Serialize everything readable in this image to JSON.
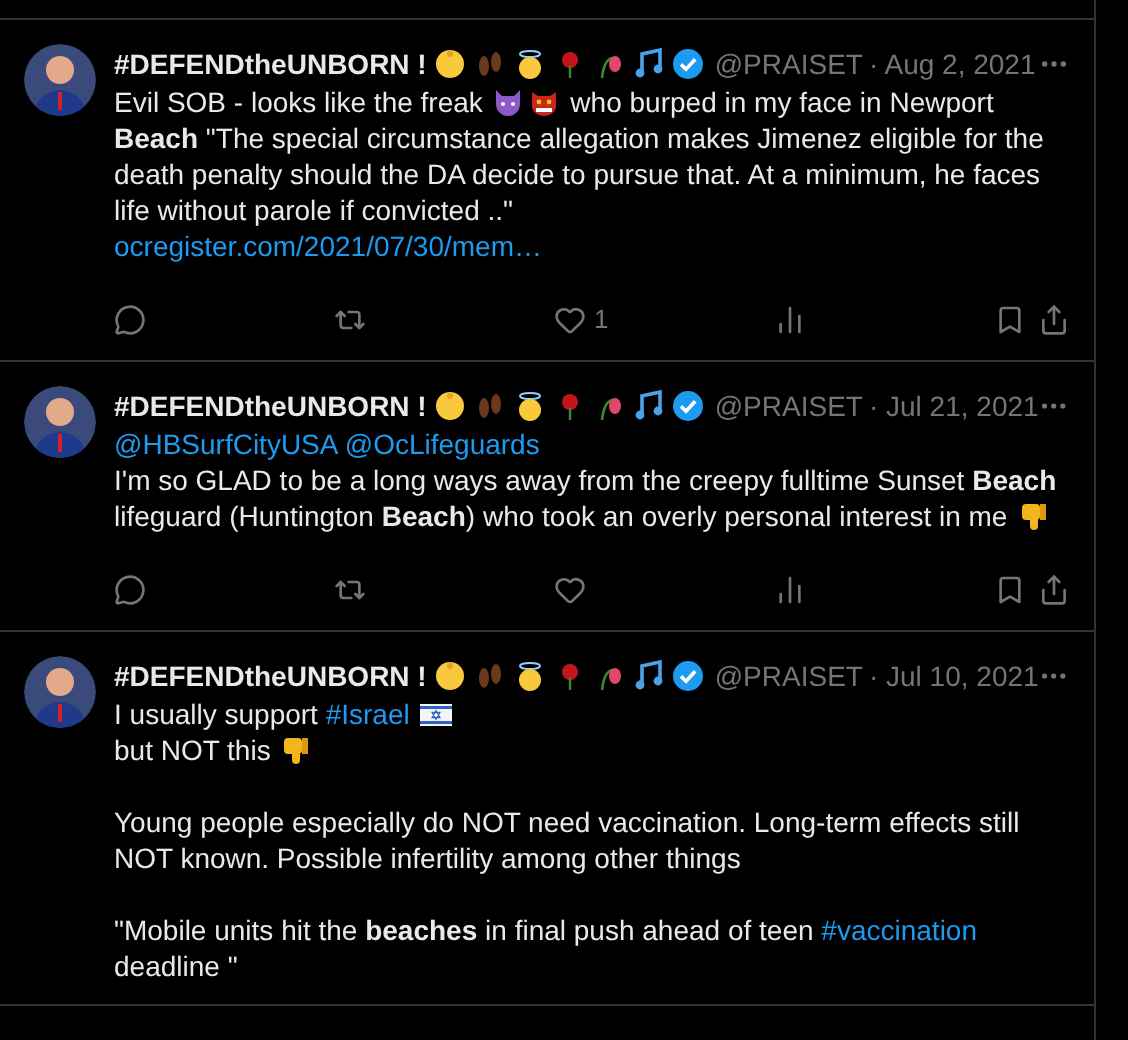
{
  "tweets": [
    {
      "name": "#DEFENDtheUNBORN !",
      "handle": "@PRAISET",
      "date": "· Aug 2, 2021",
      "liked": false,
      "like_count": "1",
      "blocks": [
        [
          {
            "kind": "text",
            "text": "Evil SOB - looks like the freak "
          },
          {
            "kind": "devil"
          },
          {
            "kind": "ogre"
          },
          {
            "kind": "text",
            "text": " who burped in my face in Newport **Beach**  \"The special circumstance allegation makes Jimenez eligible for the death penalty should the DA decide to pursue that. At a minimum, he faces life without parole if convicted ..\""
          },
          {
            "kind": "break"
          },
          {
            "kind": "link",
            "text": "ocregister.com/2021/07/30/mem…"
          }
        ]
      ]
    },
    {
      "name": "#DEFENDtheUNBORN !",
      "handle": "@PRAISET",
      "date": "· Jul 21, 2021",
      "liked": false,
      "blocks": [
        [
          {
            "kind": "link",
            "text": "@HBSurfCityUSA"
          },
          {
            "kind": "space"
          },
          {
            "kind": "link",
            "text": "@OcLifeguards"
          },
          {
            "kind": "break"
          },
          {
            "kind": "text",
            "text": "I'm so GLAD to be a long ways away from the creepy fulltime Sunset **Beach** lifeguard (Huntington **Beach**) who took an overly personal interest in me "
          },
          {
            "kind": "thumbsdown"
          }
        ]
      ]
    },
    {
      "name": "#DEFENDtheUNBORN !",
      "handle": "@PRAISET",
      "date": "· Jul 10, 2021",
      "blocks": [
        [
          {
            "kind": "text",
            "text": "I usually support "
          },
          {
            "kind": "link",
            "text": "#Israel"
          },
          {
            "kind": "space"
          },
          {
            "kind": "flag"
          },
          {
            "kind": "break"
          },
          {
            "kind": "text",
            "text": " but NOT this "
          },
          {
            "kind": "thumbsdown"
          }
        ],
        [
          {
            "kind": "text",
            "text": "Young people especially do NOT need vaccination. Long-term effects still NOT known. Possible infertility among other things"
          }
        ],
        [
          {
            "kind": "text",
            "text": "\"Mobile units hit the **beaches** in final push ahead of teen "
          },
          {
            "kind": "link",
            "text": "#vaccination"
          },
          {
            "kind": "text",
            "text": " deadline \""
          }
        ]
      ]
    }
  ]
}
